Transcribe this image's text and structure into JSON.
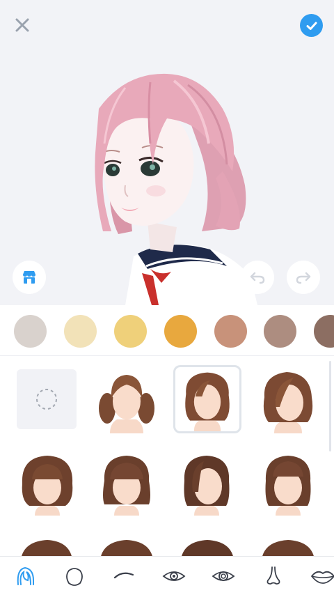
{
  "header": {
    "close_icon": "close-icon",
    "confirm_icon": "checkmark-icon",
    "accent_color": "#2f9cf0"
  },
  "preview": {
    "hair_color": "#e9aebd",
    "store_icon": "store-icon",
    "undo_icon": "undo-icon",
    "redo_icon": "redo-icon"
  },
  "hair_colors": [
    "#d9d2cd",
    "#f2e2b8",
    "#efd07a",
    "#e8a83e",
    "#c8927a",
    "#ad8d80",
    "#8c6e62"
  ],
  "hairstyles": [
    {
      "name": "none"
    },
    {
      "name": "twin-tails"
    },
    {
      "name": "wavy-bob",
      "selected": true
    },
    {
      "name": "side-swept-bob"
    },
    {
      "name": "curly-bangs"
    },
    {
      "name": "bangs-with-braids"
    },
    {
      "name": "side-part-bob"
    },
    {
      "name": "blunt-bangs-bob"
    }
  ],
  "nav": [
    {
      "name": "hair-icon",
      "active": true
    },
    {
      "name": "face-shape-icon"
    },
    {
      "name": "eyebrow-icon"
    },
    {
      "name": "eye-icon"
    },
    {
      "name": "eye-detail-icon"
    },
    {
      "name": "nose-icon"
    },
    {
      "name": "lips-icon"
    }
  ]
}
